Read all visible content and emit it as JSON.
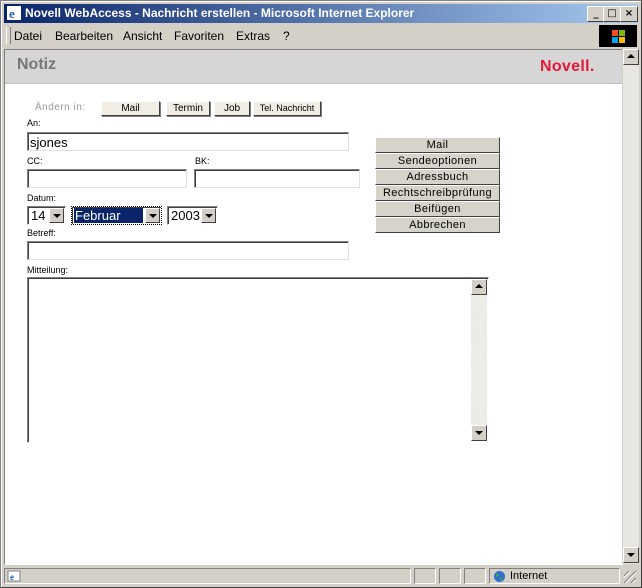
{
  "window": {
    "title": "Novell WebAccess - Nachricht erstellen - Microsoft Internet Explorer"
  },
  "menu": {
    "items": [
      "Datei",
      "Bearbeiten",
      "Ansicht",
      "Favoriten",
      "Extras",
      "?"
    ]
  },
  "header": {
    "page_title": "Notiz",
    "brand": "Novell."
  },
  "tabs": {
    "label": "Ändern in:",
    "items": [
      "Mail",
      "Termin",
      "Job",
      "Tel. Nachricht"
    ]
  },
  "form": {
    "to_label": "An:",
    "to_value": "sjones",
    "cc_label": "CC:",
    "bcc_label": "BK:",
    "date_label": "Datum:",
    "day": "14",
    "month": "Februar",
    "year": "2003",
    "subject_label": "Betreff:",
    "message_label": "Mitteilung:"
  },
  "actions": [
    "Mail",
    "Sendeoptionen",
    "Adressbuch",
    "Rechtschreibprüfung",
    "Beifügen",
    "Abbrechen"
  ],
  "status": {
    "zone": "Internet"
  },
  "colors": {
    "title_bar": "#0a246a",
    "brand": "#e31937",
    "selected": "#0a246a"
  }
}
